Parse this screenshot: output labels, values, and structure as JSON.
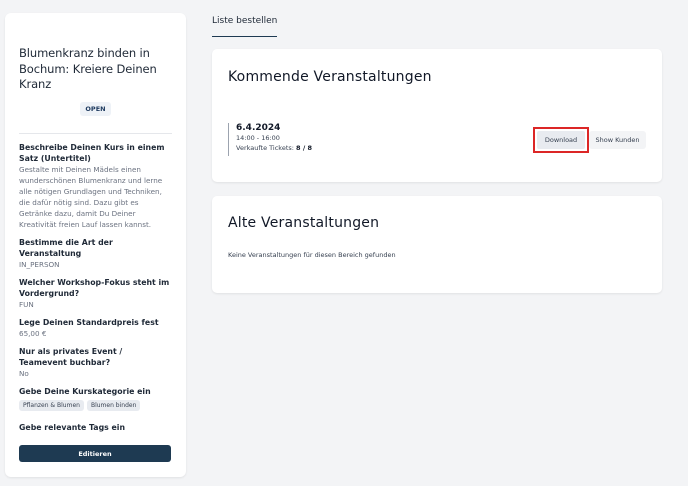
{
  "sidebar": {
    "title": "Blumenkranz binden in Bochum: Kreiere Deinen Kranz",
    "status": "OPEN",
    "fields": [
      {
        "label": "Beschreibe Deinen Kurs in einem Satz (Untertitel)",
        "value": "Gestalte mit Deinen Mädels einen wunderschönen Blumenkranz und lerne alle nötigen Grundlagen und Techniken, die dafür nötig sind. Dazu gibt es Getränke dazu, damit Du Deiner Kreativität freien Lauf lassen kannst."
      },
      {
        "label": "Bestimme die Art der Veranstaltung",
        "value": "IN_PERSON"
      },
      {
        "label": "Welcher Workshop-Fokus steht im Vordergrund?",
        "value": "FUN"
      },
      {
        "label": "Lege Deinen Standardpreis fest",
        "value": "65,00 €"
      },
      {
        "label": "Nur als privates Event / Teamevent buchbar?",
        "value": "No"
      }
    ],
    "category_label": "Gebe Deine Kurskategorie ein",
    "categories": [
      "Pflanzen & Blumen",
      "Blumen binden"
    ],
    "tags_label": "Gebe relevante Tags ein",
    "edit_label": "Editieren"
  },
  "main": {
    "tab_label": "Liste bestellen",
    "upcoming": {
      "title": "Kommende Veranstaltungen",
      "events": [
        {
          "date": "6.4.2024",
          "time": "14:00 - 16:00",
          "tickets_label": "Verkaufte Tickets:",
          "tickets_value": "8 / 8"
        }
      ],
      "download_label": "Download",
      "show_label": "Show Kunden"
    },
    "past": {
      "title": "Alte Veranstaltungen",
      "empty_text": "Keine Veranstaltungen für diesen Bereich gefunden"
    }
  },
  "colors": {
    "primary": "#1e3a52",
    "highlight": "#dc2626",
    "background": "#f3f4f6"
  }
}
